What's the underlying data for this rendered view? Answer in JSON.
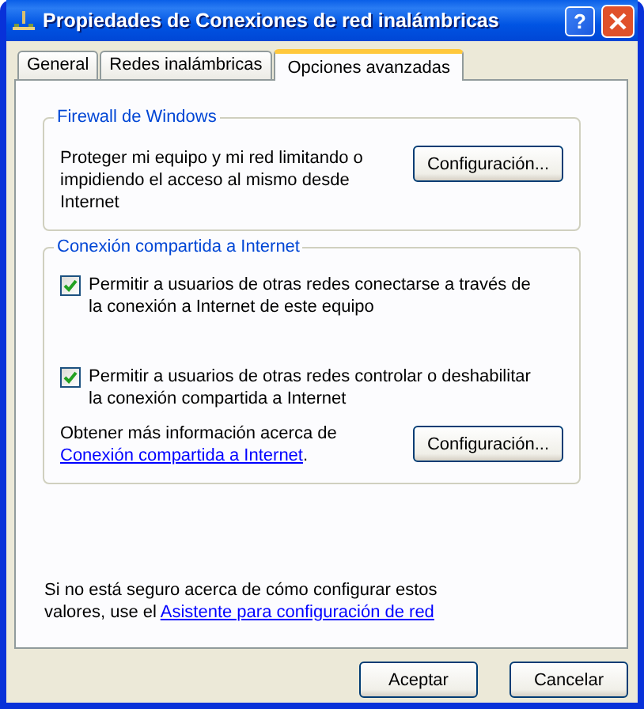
{
  "window": {
    "title": "Propiedades de Conexiones de red inalámbricas",
    "help": "?"
  },
  "tabs": [
    {
      "label": "General",
      "selected": false
    },
    {
      "label": "Redes inalámbricas",
      "selected": false
    },
    {
      "label": "Opciones avanzadas",
      "selected": true
    }
  ],
  "firewall": {
    "title": "Firewall de Windows",
    "description": "Proteger mi equipo y mi red limitando o impidiendo el acceso al mismo desde Internet",
    "button": "Configuración..."
  },
  "ics": {
    "title": "Conexión compartida a Internet",
    "options": [
      {
        "label": "Permitir a usuarios de otras redes conectarse a través de la conexión a Internet de este equipo",
        "checked": true
      },
      {
        "label": "Permitir a usuarios de otras redes controlar o deshabilitar la conexión compartida a Internet",
        "checked": true
      }
    ],
    "info": {
      "text": "Obtener más información acerca de",
      "link": "Conexión compartida a Internet",
      "end": "."
    },
    "button": "Configuración..."
  },
  "footer": {
    "text": "Si no está seguro acerca de cómo configurar estos valores, use el",
    "link": "Asistente para configuración de red"
  },
  "buttons": [
    "Aceptar",
    "Cancelar"
  ]
}
